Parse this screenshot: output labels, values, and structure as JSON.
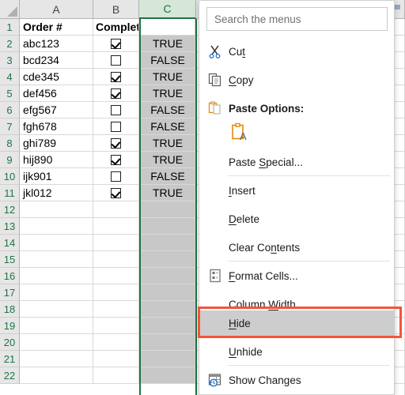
{
  "app": "excel-grid-with-context-menu",
  "grid": {
    "column_headers": [
      "A",
      "B",
      "C"
    ],
    "selected_column": "C",
    "row_numbers": [
      1,
      2,
      3,
      4,
      5,
      6,
      7,
      8,
      9,
      10,
      11,
      12,
      13,
      14,
      15,
      16,
      17,
      18,
      19,
      20,
      21,
      22
    ],
    "headers_row": {
      "A": "Order #",
      "B": "Complete",
      "C": ""
    },
    "rows": [
      {
        "row": 2,
        "order": "abc123",
        "complete": true,
        "value": "TRUE"
      },
      {
        "row": 3,
        "order": "bcd234",
        "complete": false,
        "value": "FALSE"
      },
      {
        "row": 4,
        "order": "cde345",
        "complete": true,
        "value": "TRUE"
      },
      {
        "row": 5,
        "order": "def456",
        "complete": true,
        "value": "TRUE"
      },
      {
        "row": 6,
        "order": "efg567",
        "complete": false,
        "value": "FALSE"
      },
      {
        "row": 7,
        "order": "fgh678",
        "complete": false,
        "value": "FALSE"
      },
      {
        "row": 8,
        "order": "ghi789",
        "complete": true,
        "value": "TRUE"
      },
      {
        "row": 9,
        "order": "hij890",
        "complete": true,
        "value": "TRUE"
      },
      {
        "row": 10,
        "order": "ijk901",
        "complete": false,
        "value": "FALSE"
      },
      {
        "row": 11,
        "order": "jkl012",
        "complete": true,
        "value": "TRUE"
      }
    ],
    "colors": {
      "header_fill": "#e6e6e6",
      "selected_header_fill": "#d4e7d8",
      "selected_header_text": "#217346",
      "selection_band": "#217346",
      "selected_column_fill": "#c8c8c8",
      "gridline": "#d9d9d9"
    }
  },
  "context_menu": {
    "search": {
      "placeholder": "Search the menus",
      "value": ""
    },
    "items": [
      {
        "label": "Cut",
        "icon": "scissors-icon",
        "accel": "t"
      },
      {
        "label": "Copy",
        "icon": "copy-icon",
        "accel": "C"
      },
      {
        "label": "Paste Options:",
        "icon": "clipboard-icon",
        "bold": true
      },
      {
        "label": "",
        "icon": "paste-values-text-icon"
      },
      {
        "label": "Paste Special...",
        "icon": "",
        "accel": "S"
      },
      {
        "label": "Insert",
        "icon": "",
        "accel": "I"
      },
      {
        "label": "Delete",
        "icon": "",
        "accel": "D"
      },
      {
        "label": "Clear Contents",
        "icon": "",
        "accel": "n"
      },
      {
        "label": "Format Cells...",
        "icon": "format-cells-icon",
        "accel": "F"
      },
      {
        "label": "Column Width...",
        "icon": "",
        "accel": "W"
      },
      {
        "label": "Hide",
        "icon": "",
        "accel": "H",
        "highlighted": true
      },
      {
        "label": "Unhide",
        "icon": "",
        "accel": "U"
      },
      {
        "label": "Show Changes",
        "icon": "show-changes-icon",
        "accel": "g"
      }
    ],
    "highlight_fill": "#cdcdcd",
    "annotation_color": "#f4543c"
  },
  "labels": {
    "cut": "Cut",
    "copy": "Copy",
    "paste_options": "Paste Options:",
    "paste_special": "Paste Special...",
    "insert": "Insert",
    "delete": "Delete",
    "clear_contents": "Clear Contents",
    "format_cells": "Format Cells...",
    "column_width": "Column Width...",
    "hide": "Hide",
    "unhide": "Unhide",
    "show_changes": "Show Changes"
  }
}
